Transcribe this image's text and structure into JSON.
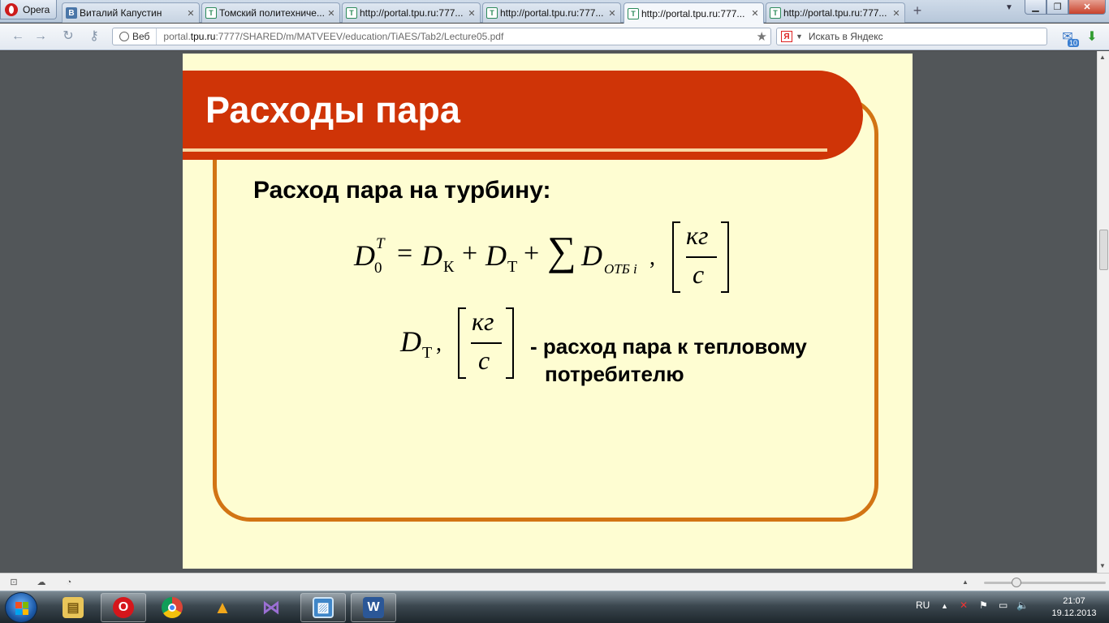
{
  "browser": {
    "opera_label": "Opera",
    "tabs": [
      {
        "label": "Виталий Капустин",
        "icon": "vk-icon"
      },
      {
        "label": "Томский политехниче...",
        "icon": "tpu-icon"
      },
      {
        "label": "http://portal.tpu.ru:777...",
        "icon": "tpu-icon"
      },
      {
        "label": "http://portal.tpu.ru:777...",
        "icon": "tpu-icon"
      },
      {
        "label": "http://portal.tpu.ru:777...",
        "icon": "tpu-icon",
        "active": true
      },
      {
        "label": "http://portal.tpu.ru:777...",
        "icon": "tpu-icon"
      }
    ],
    "address": {
      "chip": "Веб",
      "url_prefix": "portal.",
      "url_domain": "tpu.ru",
      "url_rest": ":7777/SHARED/m/MATVEEV/education/TiAES/Tab2/Lecture05.pdf"
    },
    "search_placeholder": "Искать в Яндекс",
    "badge": "10"
  },
  "slide": {
    "title": "Расходы пара",
    "subtitle": "Расход пара на турбину:",
    "formula": {
      "D": "D",
      "sub0": "0",
      "supT": "T",
      "eq": "=",
      "sub_k": "К",
      "plus": "+",
      "sub_t": "Т",
      "sigma": "∑",
      "sub_otb": "ОТБ i",
      "comma": ",",
      "unit_num": "кг",
      "unit_den": "с"
    },
    "description_line1": "- расход пара к тепловому",
    "description_line2": "потребителю"
  },
  "taskbar": {
    "lang": "RU",
    "time": "21:07",
    "date": "19.12.2013"
  },
  "colors": {
    "banner": "#cf3407",
    "frame": "#d27414",
    "slide_bg": "#fefdd2"
  }
}
